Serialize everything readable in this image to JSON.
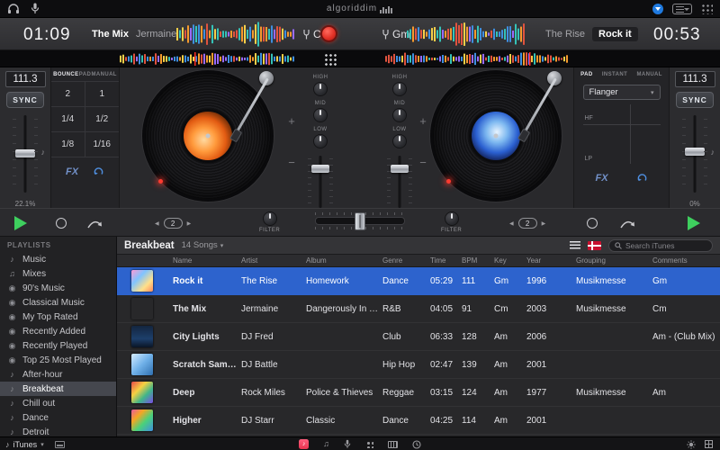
{
  "topbar": {
    "brand": "algoriddim"
  },
  "deck_a": {
    "time": "01:09",
    "title": "The Mix",
    "artist": "Jermaine",
    "key": "Cm",
    "bpm": "111.3",
    "sync_label": "SYNC",
    "pitch": "22.1%",
    "tabs": [
      "BOUNCE",
      "PAD",
      "MANUAL"
    ],
    "active_tab": "BOUNCE",
    "pads": [
      "2",
      "1",
      "1/4",
      "1/2",
      "1/8",
      "1/16"
    ],
    "fx_label": "FX",
    "loop_value": "2"
  },
  "deck_b": {
    "time": "00:53",
    "title": "Rock it",
    "artist": "The Rise",
    "key": "Gm",
    "bpm": "111.3",
    "sync_label": "SYNC",
    "pitch": "0%",
    "tabs": [
      "PAD",
      "INSTANT",
      "MANUAL"
    ],
    "active_tab": "PAD",
    "effect": "Flanger",
    "hf_label": "HF",
    "lp_label": "LP",
    "fx_label": "FX",
    "loop_value": "2"
  },
  "eq_labels": [
    "HIGH",
    "MID",
    "LOW"
  ],
  "transport": {
    "filter_label": "FILTER"
  },
  "library": {
    "sidebar_title": "PLAYLISTS",
    "playlists": [
      {
        "label": "Music",
        "icon": "music-note"
      },
      {
        "label": "Mixes",
        "icon": "mixes"
      },
      {
        "label": "90's Music",
        "icon": "smart-playlist"
      },
      {
        "label": "Classical Music",
        "icon": "smart-playlist"
      },
      {
        "label": "My Top Rated",
        "icon": "smart-playlist"
      },
      {
        "label": "Recently Added",
        "icon": "smart-playlist"
      },
      {
        "label": "Recently Played",
        "icon": "smart-playlist"
      },
      {
        "label": "Top 25 Most Played",
        "icon": "smart-playlist"
      },
      {
        "label": "After-hour",
        "icon": "playlist"
      },
      {
        "label": "Breakbeat",
        "icon": "playlist",
        "selected": true
      },
      {
        "label": "Chill out",
        "icon": "playlist"
      },
      {
        "label": "Dance",
        "icon": "playlist"
      },
      {
        "label": "Detroit",
        "icon": "playlist"
      }
    ],
    "source_label": "iTunes",
    "header_title": "Breakbeat",
    "header_count": "14 Songs",
    "search_placeholder": "Search iTunes",
    "columns": [
      "Name",
      "Artist",
      "Album",
      "Genre",
      "Time",
      "BPM",
      "Key",
      "Year",
      "Grouping",
      "Comments"
    ],
    "rows": [
      {
        "art": "rockit",
        "name": "Rock it",
        "artist": "The Rise",
        "album": "Homework",
        "genre": "Dance",
        "time": "05:29",
        "bpm": "111",
        "key": "Gm",
        "year": "1996",
        "grouping": "Musikmesse",
        "comments": "Gm",
        "selected": true
      },
      {
        "art": "themix",
        "name": "The Mix",
        "artist": "Jermaine",
        "album": "Dangerously In Love",
        "genre": "R&B",
        "time": "04:05",
        "bpm": "91",
        "key": "Cm",
        "year": "2003",
        "grouping": "Musikmesse",
        "comments": "Cm"
      },
      {
        "art": "citylights",
        "name": "City Lights",
        "artist": "DJ Fred",
        "album": "",
        "genre": "Club",
        "time": "06:33",
        "bpm": "128",
        "key": "Am",
        "year": "2006",
        "grouping": "",
        "comments": "Am - (Club Mix)"
      },
      {
        "art": "scratch",
        "name": "Scratch Sample",
        "artist": "DJ Battle",
        "album": "",
        "genre": "Hip Hop",
        "time": "02:47",
        "bpm": "139",
        "key": "Am",
        "year": "2001",
        "grouping": "",
        "comments": ""
      },
      {
        "art": "deep",
        "name": "Deep",
        "artist": "Rock Miles",
        "album": "Police & Thieves",
        "genre": "Reggae",
        "time": "03:15",
        "bpm": "124",
        "key": "Am",
        "year": "1977",
        "grouping": "Musikmesse",
        "comments": "Am"
      },
      {
        "art": "higher",
        "name": "Higher",
        "artist": "DJ Starr",
        "album": "Classic",
        "genre": "Dance",
        "time": "04:25",
        "bpm": "114",
        "key": "Am",
        "year": "2001",
        "grouping": "",
        "comments": ""
      }
    ]
  },
  "icons": {
    "chevron_down": "▾",
    "music_note": "♪",
    "beamed_notes": "♫",
    "smart_playlist": "◉",
    "left_arrow": "◀",
    "right_arrow": "▶",
    "plus": "+",
    "minus": "−"
  },
  "colors": {
    "accent_blue": "#2d63cd",
    "record_red": "#e23227",
    "play_green": "#3ecf5e"
  }
}
